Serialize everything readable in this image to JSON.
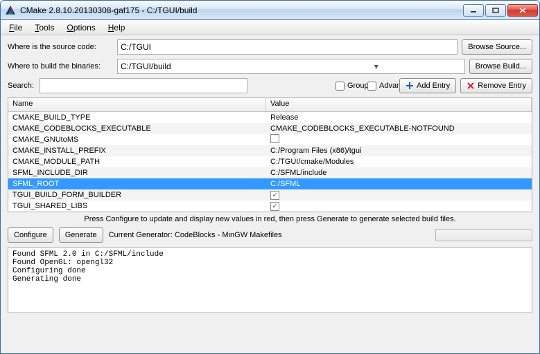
{
  "window": {
    "title": "CMake 2.8.10.20130308-gaf175 - C:/TGUI/build"
  },
  "menu": {
    "file": "File",
    "tools": "Tools",
    "options": "Options",
    "help": "Help"
  },
  "labels": {
    "source": "Where is the source code:",
    "build": "Where to build the binaries:",
    "search": "Search:",
    "grouped": "Grouped",
    "advanced": "Advanced",
    "add_entry": "Add Entry",
    "remove_entry": "Remove Entry",
    "browse_source": "Browse Source...",
    "browse_build": "Browse Build...",
    "name_col": "Name",
    "value_col": "Value",
    "hint": "Press Configure to update and display new values in red, then press Generate to generate selected build files.",
    "configure": "Configure",
    "generate": "Generate",
    "generator": "Current Generator: CodeBlocks - MinGW Makefiles"
  },
  "inputs": {
    "source": "C:/TGUI",
    "build": "C:/TGUI/build",
    "search": ""
  },
  "checks": {
    "grouped": false,
    "advanced": false
  },
  "entries": [
    {
      "name": "CMAKE_BUILD_TYPE",
      "value": "Release",
      "type": "text"
    },
    {
      "name": "CMAKE_CODEBLOCKS_EXECUTABLE",
      "value": "CMAKE_CODEBLOCKS_EXECUTABLE-NOTFOUND",
      "type": "text"
    },
    {
      "name": "CMAKE_GNUtoMS",
      "value": false,
      "type": "bool"
    },
    {
      "name": "CMAKE_INSTALL_PREFIX",
      "value": "C:/Program Files (x86)/tgui",
      "type": "text"
    },
    {
      "name": "CMAKE_MODULE_PATH",
      "value": "C:/TGUI/cmake/Modules",
      "type": "text"
    },
    {
      "name": "SFML_INCLUDE_DIR",
      "value": "C:/SFML/include",
      "type": "text"
    },
    {
      "name": "SFML_ROOT",
      "value": "C:/SFML",
      "type": "text",
      "selected": true
    },
    {
      "name": "TGUI_BUILD_FORM_BUILDER",
      "value": true,
      "type": "bool"
    },
    {
      "name": "TGUI_SHARED_LIBS",
      "value": true,
      "type": "bool"
    }
  ],
  "output": "Found SFML 2.0 in C:/SFML/include\nFound OpenGL: opengl32\nConfiguring done\nGenerating done"
}
